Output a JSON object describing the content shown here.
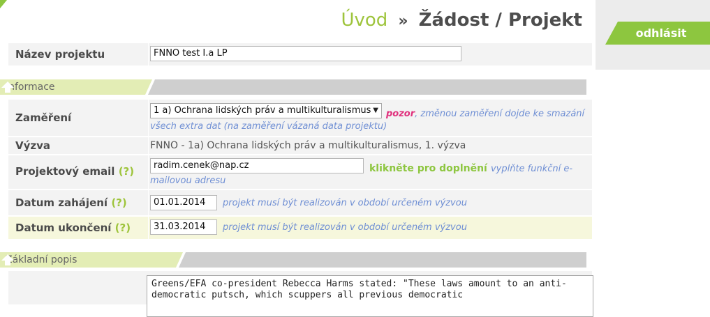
{
  "breadcrumb": {
    "home": "Úvod",
    "separator": "»",
    "current": "Žádost / Projekt"
  },
  "logout": {
    "label": "odhlásit"
  },
  "project_name": {
    "label": "Název projektu",
    "value": "FNNO test I.a LP"
  },
  "sections": {
    "info": {
      "title": "Informace"
    },
    "basic": {
      "title": "Základní popis"
    }
  },
  "focus": {
    "label": "Zaměření",
    "selected": "1 a) Ochrana lidských práv a multikulturalismus",
    "warn": "pozor",
    "note_line1": ", změnou zaměření dojde ke smazání",
    "note_line2": "všech extra dat (na zaměření vázaná data projektu)"
  },
  "call": {
    "label": "Výzva",
    "value": "FNNO - 1a) Ochrana lidských práv a multikulturalismus, 1. výzva"
  },
  "email": {
    "label": "Projektový email",
    "help": "(?)",
    "value": "radim.cenek@nap.cz",
    "action": "klikněte pro doplnění",
    "note_line1": "vyplňte funkční e-",
    "note_line2": "mailovou adresu"
  },
  "start_date": {
    "label": "Datum zahájení",
    "help": "(?)",
    "value": "01.01.2014",
    "note": "projekt musí být realizován v období určeném výzvou"
  },
  "end_date": {
    "label": "Datum ukončení",
    "help": "(?)",
    "value": "31.03.2014",
    "note": "projekt musí být realizován v období určeném výzvou"
  },
  "description": {
    "text": "Greens/EFA co-president Rebecca Harms stated: \"These laws amount to an anti-democratic putsch, which scuppers all previous democratic"
  },
  "colors": {
    "accent": "#8dc63f",
    "warn": "#e0317d",
    "note": "#6f8fd4"
  }
}
